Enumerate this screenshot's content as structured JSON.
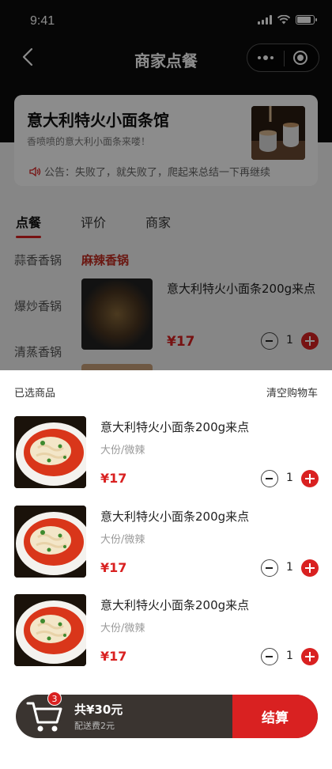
{
  "status_bar": {
    "time": "9:41"
  },
  "nav": {
    "title": "商家点餐"
  },
  "shop": {
    "name": "意大利特火小面条馆",
    "slogan": "香喷喷的意大利小面条来喽！",
    "notice": "公告：失败了，就失败了，爬起来总结一下再继续"
  },
  "tabs": [
    {
      "label": "点餐"
    },
    {
      "label": "评价"
    },
    {
      "label": "商家"
    }
  ],
  "categories": [
    {
      "label": "蒜香香锅"
    },
    {
      "label": "爆炒香锅"
    },
    {
      "label": "清蒸香锅"
    }
  ],
  "menu": {
    "section_title": "麻辣香锅",
    "product": {
      "name": "意大利特火小面条200g来点",
      "price": "¥17",
      "qty": "1"
    }
  },
  "cart": {
    "title": "已选商品",
    "clear_label": "清空购物车",
    "items": [
      {
        "name": "意大利特火小面条200g来点",
        "spec": "大份/微辣",
        "price": "¥17",
        "qty": "1"
      },
      {
        "name": "意大利特火小面条200g来点",
        "spec": "大份/微辣",
        "price": "¥17",
        "qty": "1"
      },
      {
        "name": "意大利特火小面条200g来点",
        "spec": "大份/微辣",
        "price": "¥17",
        "qty": "1"
      }
    ]
  },
  "bottom_bar": {
    "badge_count": "3",
    "total": "共¥30元",
    "delivery_fee": "配送费2元",
    "checkout_label": "结算"
  },
  "colors": {
    "accent": "#d92121",
    "bar": "#3a3430",
    "header": "#0c0c0c"
  }
}
